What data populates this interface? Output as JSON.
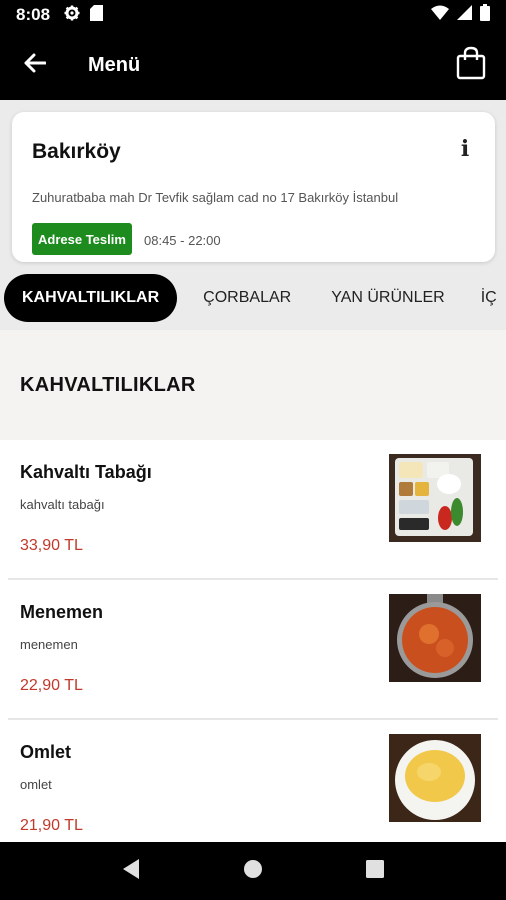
{
  "status": {
    "time": "8:08"
  },
  "app_bar": {
    "title": "Menü"
  },
  "store": {
    "name": "Bakırköy",
    "address": "Zuhuratbaba mah Dr Tevfik sağlam cad no 17 Bakırköy İstanbul",
    "delivery_label": "Adrese Teslim",
    "hours": "08:45 - 22:00",
    "info_glyph": "i"
  },
  "tabs": [
    {
      "label": "KAHVALTILIKLAR",
      "active": true
    },
    {
      "label": "ÇORBALAR",
      "active": false
    },
    {
      "label": "YAN ÜRÜNLER",
      "active": false
    },
    {
      "label": "İÇ",
      "active": false
    }
  ],
  "section": {
    "title": "KAHVALTILIKLAR"
  },
  "items": [
    {
      "name": "Kahvaltı Tabağı",
      "description": "kahvaltı tabağı",
      "price": "33,90 TL"
    },
    {
      "name": "Menemen",
      "description": "menemen",
      "price": "22,90 TL"
    },
    {
      "name": "Omlet",
      "description": "omlet",
      "price": "21,90 TL"
    }
  ],
  "colors": {
    "price": "#c0392b",
    "delivery_badge": "#1e8b1e",
    "app_bar": "#000000"
  },
  "icons": [
    "settings-gear-icon",
    "sd-card-icon",
    "wifi-icon",
    "signal-icon",
    "battery-icon",
    "back-arrow-icon",
    "shopping-bag-icon",
    "info-icon",
    "nav-back-icon",
    "nav-home-icon",
    "nav-recents-icon"
  ]
}
